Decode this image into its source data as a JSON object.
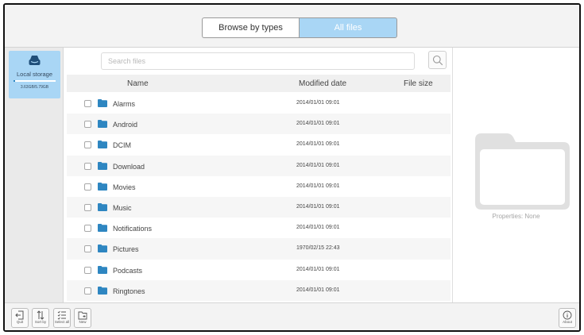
{
  "header": {
    "tabs": [
      {
        "label": "Browse by types",
        "active": false
      },
      {
        "label": "All files",
        "active": true
      }
    ],
    "active_color": "#a9d6f5"
  },
  "sidebar": {
    "storage": {
      "label": "Local storage",
      "size_text": "3.63GB/5.79GB",
      "icon": "drive-icon",
      "used_fraction": 0.03
    }
  },
  "search": {
    "placeholder": "Search files",
    "icon": "search-icon"
  },
  "table": {
    "columns": [
      "Name",
      "Modified date",
      "File size"
    ],
    "rows": [
      {
        "name": "Alarms",
        "date": "2014/01/01 09:01",
        "size": ""
      },
      {
        "name": "Android",
        "date": "2014/01/01 09:01",
        "size": ""
      },
      {
        "name": "DCIM",
        "date": "2014/01/01 09:01",
        "size": ""
      },
      {
        "name": "Download",
        "date": "2014/01/01 09:01",
        "size": ""
      },
      {
        "name": "Movies",
        "date": "2014/01/01 09:01",
        "size": ""
      },
      {
        "name": "Music",
        "date": "2014/01/01 09:01",
        "size": ""
      },
      {
        "name": "Notifications",
        "date": "2014/01/01 09:01",
        "size": ""
      },
      {
        "name": "Pictures",
        "date": "1970/02/15 22:43",
        "size": ""
      },
      {
        "name": "Podcasts",
        "date": "2014/01/01 09:01",
        "size": ""
      },
      {
        "name": "Ringtones",
        "date": "2014/01/01 09:01",
        "size": ""
      }
    ],
    "folder_color": "#2e86c1"
  },
  "preview": {
    "icon": "folder-large-icon",
    "properties_text": "Properties: None"
  },
  "toolbar": {
    "quit_label": "Quit",
    "sort_label": "Sort by",
    "select_all_label": "Select all",
    "new_label": "New",
    "about_label": "About"
  }
}
